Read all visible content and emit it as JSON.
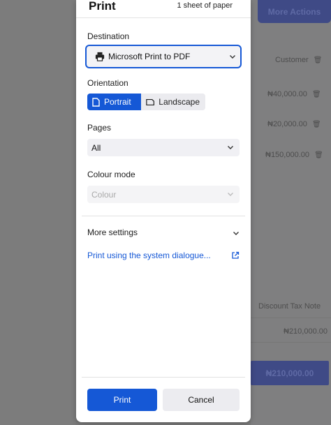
{
  "dialog": {
    "title": "Print",
    "sheet_count": "1 sheet of paper",
    "destination": {
      "label": "Destination",
      "value": "Microsoft Print to PDF"
    },
    "orientation": {
      "label": "Orientation",
      "options": [
        "Portrait",
        "Landscape"
      ],
      "selected": "Portrait"
    },
    "pages": {
      "label": "Pages",
      "value": "All"
    },
    "colour_mode": {
      "label": "Colour mode",
      "value": "Colour"
    },
    "more_settings": "More settings",
    "system_dialog_link": "Print using the system dialogue...",
    "print_button": "Print",
    "cancel_button": "Cancel"
  },
  "background_page": {
    "more_actions": "More Actions",
    "customer_header": "Customer",
    "row_amounts": [
      "₦40,000.00",
      "₦20,000.00",
      "₦150,000.00"
    ],
    "summary_headers": "Discount  Tax  Note",
    "subtotal": "₦210,000.00",
    "total": "₦210,000.00"
  },
  "colors": {
    "accent": "#1558d6",
    "background_button": "#3f4a86"
  }
}
